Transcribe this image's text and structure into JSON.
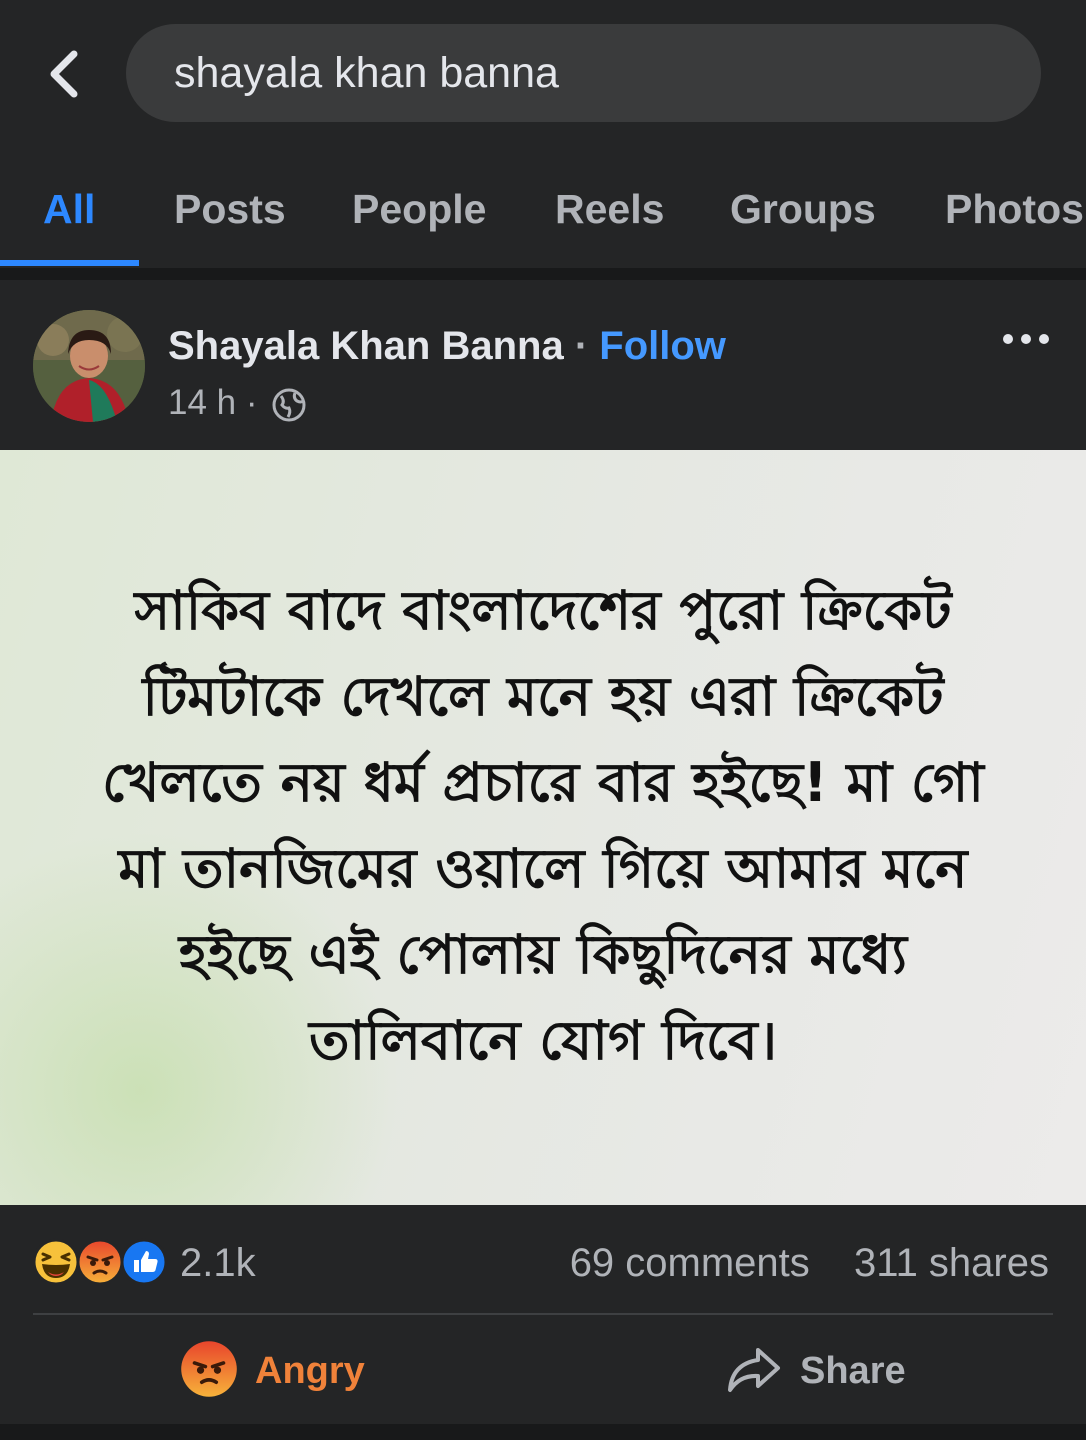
{
  "search": {
    "query": "shayala khan banna"
  },
  "tabs": [
    {
      "label": "All",
      "active": true
    },
    {
      "label": "Posts"
    },
    {
      "label": "People"
    },
    {
      "label": "Reels"
    },
    {
      "label": "Groups"
    },
    {
      "label": "Photos"
    }
  ],
  "post": {
    "author": "Shayala Khan Banna",
    "separator": "·",
    "follow_label": "Follow",
    "time": "14 h",
    "meta_separator": "·",
    "privacy_icon": "globe-icon",
    "image_text": "সাকিব বাদে বাংলাদেশের পুরো ক্রিকেট টিমটাকে দেখলে মনে হয় এরা ক্রিকেট খেলতে নয় ধর্ম প্রচারে বার হইছে! মা গো মা তানজিমের ওয়ালে গিয়ে আমার মনে হইছে এই পোলায় কিছুদিনের মধ্যে তালিবানে যোগ দিবে।"
  },
  "stats": {
    "reactions": [
      "haha",
      "angry",
      "like"
    ],
    "reaction_count": "2.1k",
    "comments": "69 comments",
    "shares": "311 shares"
  },
  "actions": {
    "reaction_label": "Angry",
    "share_label": "Share"
  },
  "colors": {
    "background": "#242526",
    "accent": "#2d88ff",
    "follow": "#4599ff",
    "angry": "#f0823a"
  }
}
